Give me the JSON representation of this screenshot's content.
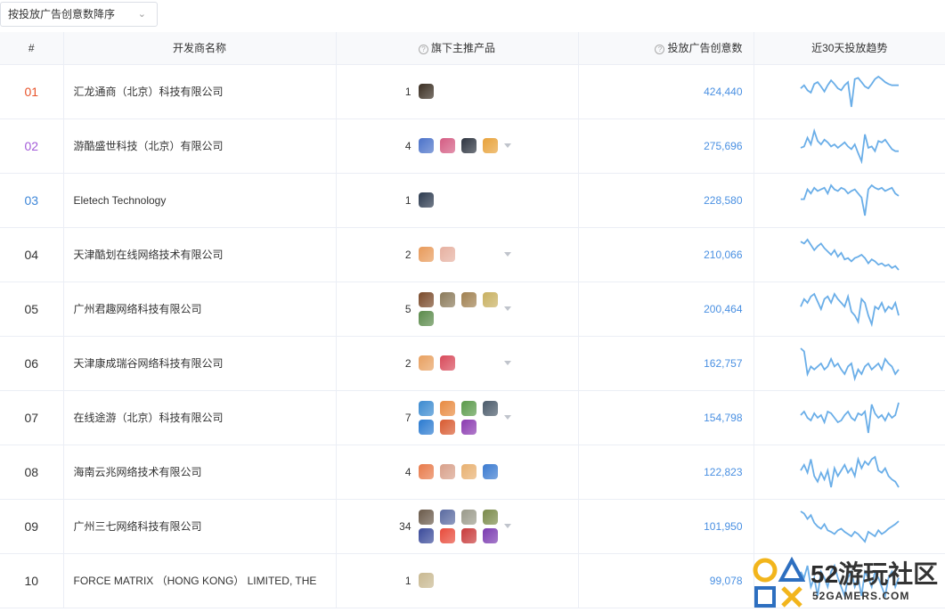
{
  "sort": {
    "label": "按投放广告创意数降序"
  },
  "columns": {
    "rank": "#",
    "developer": "开发商名称",
    "products": "旗下主推产品",
    "ads": "投放广告创意数",
    "trend": "近30天投放趋势"
  },
  "rows": [
    {
      "rank": "01",
      "rank_color": "#e8542c",
      "developer": "汇龙通商（北京）科技有限公司",
      "count": "1",
      "icons": [
        "#3a2e22"
      ],
      "has_caret": false,
      "ads": "424,440",
      "trend": [
        55,
        50,
        58,
        62,
        48,
        45,
        52,
        60,
        50,
        42,
        48,
        55,
        58,
        50,
        45,
        85,
        40,
        38,
        45,
        52,
        55,
        48,
        40,
        36,
        40,
        45,
        48,
        50,
        50,
        50
      ]
    },
    {
      "rank": "02",
      "rank_color": "#a35bd8",
      "developer": "游酷盛世科技（北京）有限公司",
      "count": "4",
      "icons": [
        "#4b72c9",
        "#d45c83",
        "#2d3440",
        "#e8a23a"
      ],
      "has_caret": true,
      "ads": "275,696",
      "trend": [
        50,
        48,
        35,
        45,
        25,
        40,
        45,
        38,
        42,
        48,
        45,
        50,
        46,
        42,
        48,
        52,
        45,
        58,
        70,
        30,
        50,
        48,
        55,
        40,
        42,
        38,
        45,
        52,
        55,
        55
      ]
    },
    {
      "rank": "03",
      "rank_color": "#3d86d8",
      "developer": "Eletech Technology",
      "count": "1",
      "icons": [
        "#2c3a4f"
      ],
      "has_caret": false,
      "ads": "228,580",
      "trend": [
        42,
        42,
        30,
        35,
        28,
        32,
        30,
        28,
        35,
        25,
        30,
        32,
        28,
        30,
        35,
        32,
        30,
        35,
        40,
        62,
        30,
        25,
        28,
        30,
        28,
        32,
        30,
        28,
        35,
        38
      ]
    },
    {
      "rank": "04",
      "rank_color": "#333333",
      "developer": "天津酷划在线网络技术有限公司",
      "count": "2",
      "icons": [
        "#e89a5a",
        "#e6b0a0"
      ],
      "has_caret": true,
      "ads": "210,066",
      "trend": [
        25,
        28,
        22,
        30,
        38,
        32,
        28,
        35,
        40,
        45,
        38,
        48,
        42,
        52,
        50,
        55,
        50,
        48,
        45,
        50,
        58,
        52,
        55,
        60,
        58,
        62,
        60,
        65,
        62,
        68
      ]
    },
    {
      "rank": "05",
      "rank_color": "#333333",
      "developer": "广州君趣网络科技有限公司",
      "count": "5",
      "icons": [
        "#7a4a2a",
        "#8b7a5a",
        "#a08050",
        "#c8b060",
        "#5a8a4a"
      ],
      "has_caret": true,
      "ads": "200,464",
      "trend": [
        48,
        42,
        45,
        40,
        38,
        44,
        50,
        42,
        40,
        45,
        38,
        42,
        45,
        48,
        40,
        52,
        55,
        60,
        42,
        45,
        55,
        62,
        48,
        50,
        45,
        52,
        48,
        50,
        45,
        55
      ]
    },
    {
      "rank": "06",
      "rank_color": "#333333",
      "developer": "天津康成瑞谷网络科技有限公司",
      "count": "2",
      "icons": [
        "#e8a060",
        "#d84a5a"
      ],
      "has_caret": true,
      "ads": "162,757",
      "trend": [
        28,
        30,
        45,
        40,
        42,
        40,
        38,
        42,
        40,
        35,
        40,
        38,
        42,
        45,
        40,
        38,
        48,
        42,
        45,
        40,
        38,
        42,
        40,
        38,
        42,
        35,
        38,
        40,
        45,
        42
      ]
    },
    {
      "rank": "07",
      "rank_color": "#333333",
      "developer": "在线途游（北京）科技有限公司",
      "count": "7",
      "icons": [
        "#3a8ad0",
        "#e88a40",
        "#5a9a4a",
        "#4a5a6a",
        "#2a7ad0",
        "#d85a30",
        "#8a3ab0"
      ],
      "has_caret": true,
      "ads": "154,798",
      "trend": [
        42,
        38,
        45,
        48,
        40,
        45,
        42,
        50,
        38,
        40,
        45,
        50,
        48,
        42,
        38,
        45,
        48,
        40,
        42,
        38,
        62,
        30,
        40,
        45,
        42,
        48,
        40,
        45,
        42,
        28
      ]
    },
    {
      "rank": "08",
      "rank_color": "#333333",
      "developer": "海南云兆网络技术有限公司",
      "count": "4",
      "icons": [
        "#e87a4a",
        "#d8a08a",
        "#e8b070",
        "#3a7ad0"
      ],
      "has_caret": false,
      "ads": "122,823",
      "trend": [
        40,
        35,
        42,
        30,
        45,
        50,
        42,
        48,
        40,
        55,
        38,
        45,
        40,
        35,
        42,
        38,
        45,
        30,
        38,
        32,
        35,
        30,
        28,
        40,
        42,
        38,
        45,
        48,
        50,
        55
      ]
    },
    {
      "rank": "09",
      "rank_color": "#333333",
      "developer": "广州三七网络科技有限公司",
      "count": "34",
      "icons": [
        "#6a5a4a",
        "#5a6aa0",
        "#9a9a8a",
        "#7a8a4a",
        "#3a4a9a",
        "#e84a3a",
        "#c83a3a",
        "#7a3ab0"
      ],
      "has_caret": true,
      "ads": "101,950",
      "trend": [
        25,
        28,
        35,
        30,
        40,
        45,
        48,
        42,
        50,
        52,
        55,
        50,
        48,
        52,
        55,
        58,
        52,
        55,
        60,
        65,
        52,
        55,
        58,
        50,
        55,
        52,
        48,
        45,
        42,
        38
      ]
    },
    {
      "rank": "10",
      "rank_color": "#333333",
      "developer": "FORCE MATRIX （HONG KONG） LIMITED, THE",
      "count": "1",
      "icons": [
        "#c8b890"
      ],
      "has_caret": false,
      "ads": "99,078",
      "trend": [
        40,
        42,
        38,
        45,
        42,
        48,
        40,
        42,
        45,
        40,
        38,
        42,
        45,
        48,
        42,
        40,
        45,
        42,
        48,
        40,
        42,
        45,
        40,
        42,
        45,
        48,
        42,
        40,
        45,
        42
      ]
    }
  ],
  "watermark": {
    "number": "52",
    "text": "游玩社区",
    "domain": "52GAMERS.COM"
  },
  "colors": {
    "accent": "#4a90e2",
    "trend_line": "#6aaee8"
  }
}
